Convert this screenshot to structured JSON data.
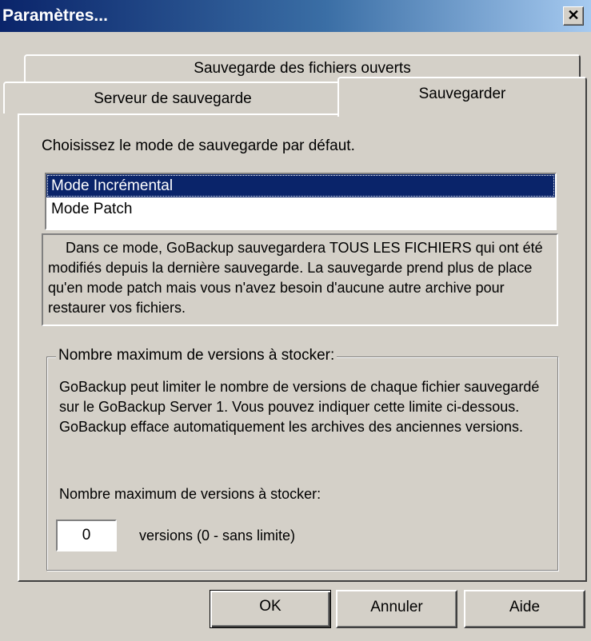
{
  "window": {
    "title": "Paramètres...",
    "close_glyph": "✕"
  },
  "tabs": {
    "row1": [
      {
        "label": "Sauvegarde des fichiers ouverts"
      }
    ],
    "row2": [
      {
        "label": "Serveur de sauvegarde"
      },
      {
        "label": "Sauvegarder",
        "selected": true
      }
    ]
  },
  "panel": {
    "prompt": "Choisissez le mode de sauvegarde par défaut.",
    "modes": [
      {
        "label": "Mode Incrémental",
        "selected": true
      },
      {
        "label": "Mode Patch",
        "selected": false
      }
    ],
    "description": "Dans ce mode, GoBackup sauvegardera TOUS LES FICHIERS qui ont été modifiés depuis la dernière sauvegarde. La sauvegarde prend plus de place qu'en mode patch mais vous n'avez besoin d'aucune autre archive pour restaurer vos fichiers.",
    "group": {
      "legend": "Nombre maximum de versions à stocker:",
      "text": "GoBackup peut limiter le nombre de versions de chaque fichier sauvegardé sur le GoBackup Server 1. Vous pouvez indiquer cette limite ci-dessous. GoBackup efface automatiquement les archives des anciennes versions.",
      "field_label": "Nombre maximum de versions à stocker:",
      "field_value": "0",
      "field_suffix": "versions (0 - sans limite)"
    }
  },
  "buttons": {
    "ok": "OK",
    "cancel": "Annuler",
    "help": "Aide"
  },
  "colors": {
    "face": "#d4d0c8",
    "title_start": "#0a246a",
    "title_end": "#a6caf0",
    "selection": "#0a246a"
  }
}
